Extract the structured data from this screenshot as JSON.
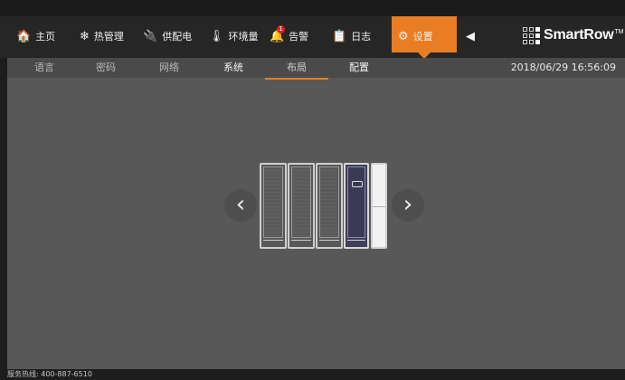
{
  "topnav": {
    "items": [
      {
        "label": "主页",
        "icon": "home-icon",
        "glyph": "🏠"
      },
      {
        "label": "热管理",
        "icon": "snowflake-icon",
        "glyph": "❄"
      },
      {
        "label": "供配电",
        "icon": "power-plug-icon",
        "glyph": "🔌"
      },
      {
        "label": "环境量",
        "icon": "thermometer-icon",
        "glyph": "🌡"
      },
      {
        "label": "告警",
        "icon": "alarm-icon",
        "glyph": "🔔"
      },
      {
        "label": "日志",
        "icon": "clipboard-icon",
        "glyph": "📋"
      },
      {
        "label": "设置",
        "icon": "gear-icon",
        "glyph": "⚙"
      },
      {
        "label": "",
        "icon": "speaker-icon",
        "glyph": "◀"
      }
    ],
    "alarm_badge": "1",
    "active_index": 6,
    "accent": "#e87d23"
  },
  "logo": {
    "text": "SmartRow",
    "tm": "TM"
  },
  "subnav": {
    "tabs": [
      "语言",
      "密码",
      "网络",
      "系统",
      "布局",
      "配置"
    ],
    "active_index": 4
  },
  "datetime": "2018/06/29 16:56:09",
  "layout_view": {
    "prev_glyph": "‹",
    "next_glyph": "›",
    "racks": [
      "rack",
      "rack",
      "rack",
      "rack-selected",
      "end-panel"
    ]
  },
  "footer": {
    "hotline": "服务热线:  400-887-6510"
  }
}
